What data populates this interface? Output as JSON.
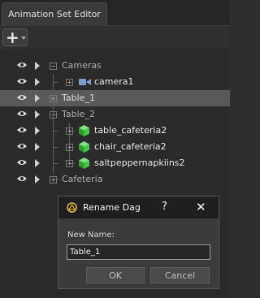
{
  "tab": {
    "label": "Animation Set Editor"
  },
  "toolbar": {
    "add_label": "+"
  },
  "tree": {
    "rows": [
      {
        "label": "Cameras",
        "kind": "group"
      },
      {
        "label": "camera1",
        "kind": "camera"
      },
      {
        "label": "Table_1",
        "kind": "group",
        "selected": true
      },
      {
        "label": "Table_2",
        "kind": "group"
      },
      {
        "label": "table_cafeteria2",
        "kind": "model"
      },
      {
        "label": "chair_cafeteria2",
        "kind": "model"
      },
      {
        "label": "saltpeppernapkiins2",
        "kind": "model"
      },
      {
        "label": "Cafeteria",
        "kind": "group"
      }
    ]
  },
  "dialog": {
    "title": "Rename Dag",
    "help": "?",
    "close": "✕",
    "field_label": "New Name:",
    "field_value": "Table_1",
    "ok_label": "OK",
    "cancel_label": "Cancel"
  }
}
